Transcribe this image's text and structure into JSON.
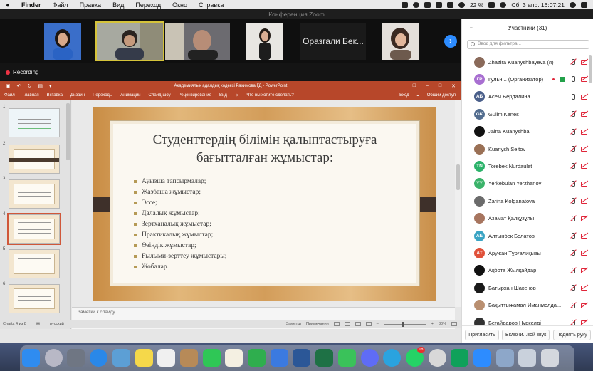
{
  "menubar": {
    "apple_icon": "apple-icon",
    "app": "Finder",
    "items": [
      "Файл",
      "Правка",
      "Вид",
      "Переход",
      "Окно",
      "Справка"
    ],
    "battery": "22 %",
    "datetime": "Сб, 3 апр.  16:07:21"
  },
  "zoom": {
    "window_title": "Конференция Zoom",
    "recording_label": "Recording",
    "name_tile": "Оразгали Бек...",
    "next_icon": "chevron-right-icon"
  },
  "ppt": {
    "doc_title": "Академиялық адалдық кодексі Рахимова ГД - PowerPoint",
    "ribbon_tabs": [
      "Файл",
      "Главная",
      "Вставка",
      "Дизайн",
      "Переходы",
      "Анимации",
      "Слайд-шоу",
      "Рецензирование",
      "Вид"
    ],
    "tell_me": "Что вы хотите сделать?",
    "sign_in": "Вход",
    "share": "Общий доступ",
    "slide_numbers": [
      "1",
      "2",
      "3",
      "4",
      "5",
      "6"
    ],
    "slide": {
      "title_line1": "Студенттердің білімін қалыптастыруға",
      "title_line2": "бағытталған жұмыстар:",
      "bullets": [
        "Ауызша тапсырмалар;",
        "Жазбаша жұмыстар;",
        "Эссе;",
        "Далалық жұмыстар;",
        "Зертханалық жұмыстар;",
        "Практикалық жұмыстар;",
        "Өзіндік жұмыстар;",
        "Ғылыми-зерттеу жұмыстары;",
        "Жобалар."
      ]
    },
    "notes_placeholder": "Заметки к слайду",
    "status": {
      "slide_of": "Слайд 4 из 8",
      "language": "русский",
      "notes": "Заметки",
      "comments": "Примечания",
      "zoom": "80%"
    }
  },
  "participants": {
    "header": "Участники (31)",
    "filter_placeholder": "Ввод для фильтра...",
    "list": [
      {
        "name": "Zhazira Kuanyshbayeva (я)",
        "initials": "",
        "color": "#8a6a5a",
        "mic": "off",
        "cam": "off"
      },
      {
        "name": "Гульн... (Организатор)",
        "initials": "ГР",
        "color": "#a86fd1",
        "mic": "on",
        "cam": "off"
      },
      {
        "name": "Асем Бердалина",
        "initials": "АБ",
        "color": "#4a5f8a",
        "mic": "on",
        "cam": "off"
      },
      {
        "name": "Gulim Kenes",
        "initials": "GK",
        "color": "#536d8f",
        "mic": "off",
        "cam": "off"
      },
      {
        "name": "Jaina Kuanyshbai",
        "initials": "",
        "color": "#121212",
        "mic": "off",
        "cam": "off"
      },
      {
        "name": "Kuanysh Seitov",
        "initials": "",
        "color": "#9a7055",
        "mic": "off",
        "cam": "off"
      },
      {
        "name": "Torebek Nurdaulet",
        "initials": "TN",
        "color": "#2bb36a",
        "mic": "off",
        "cam": "off"
      },
      {
        "name": "Yerkebulan Yerzhanov",
        "initials": "YY",
        "color": "#3bb36a",
        "mic": "off",
        "cam": "off"
      },
      {
        "name": "Zarina Kolganatova",
        "initials": "",
        "color": "#6b6b6b",
        "mic": "off",
        "cam": "off"
      },
      {
        "name": "Азамат Қалқұзұлы",
        "initials": "",
        "color": "#a7755f",
        "mic": "off",
        "cam": "off"
      },
      {
        "name": "Алтынбек Болатов",
        "initials": "АБ",
        "color": "#3aa4c4",
        "mic": "off",
        "cam": "off"
      },
      {
        "name": "Аружан Тұрғалиқызы",
        "initials": "АТ",
        "color": "#e0513a",
        "mic": "off",
        "cam": "off"
      },
      {
        "name": "Ақбота Жылқайдар",
        "initials": "",
        "color": "#111111",
        "mic": "off",
        "cam": "off"
      },
      {
        "name": "Батырхан Шакенов",
        "initials": "",
        "color": "#1a1a1a",
        "mic": "off",
        "cam": "off"
      },
      {
        "name": "Бақыттыжамал Иманмолда...",
        "initials": "",
        "color": "#b98f70",
        "mic": "off",
        "cam": "off"
      },
      {
        "name": "Бегайдаров Нуркелді",
        "initials": "",
        "color": "#333333",
        "mic": "off",
        "cam": "off"
      }
    ],
    "buttons": {
      "invite": "Пригласить",
      "unmute_all": "Включи...вой звук",
      "raise_hand": "Поднять руку"
    }
  },
  "dock": {
    "icons": [
      "finder-icon",
      "launchpad-icon",
      "mission-control-icon",
      "safari-icon",
      "preview-icon",
      "notes-icon",
      "reminders-icon",
      "contacts-icon",
      "facetime-icon",
      "pages-icon",
      "numbers-icon",
      "keynote-icon",
      "word-icon",
      "excel-icon",
      "messages-icon",
      "messenger-icon",
      "telegram-icon",
      "whatsapp-icon",
      "chrome-icon",
      "kaspersky-icon",
      "zoom-icon",
      "folder-icon",
      "image-capture-icon",
      "trash-icon"
    ],
    "whatsapp_badge": "18",
    "colors": {
      "finder": "#2f8cf0",
      "launchpad": "#b8b8c6",
      "mission": "#6f7683",
      "safari": "#2a88e8",
      "preview": "#5c9fd5",
      "notes": "#f5d84a",
      "reminders": "#f0f0f0",
      "contacts": "#b78a58",
      "facetime": "#2fc756",
      "pages": "#f4f0e2",
      "numbers": "#2fae4e",
      "keynote": "#3b7ae0",
      "word": "#2b5797",
      "excel": "#1e7145",
      "messages": "#3ac25a",
      "messenger": "#5f6cf6",
      "telegram": "#2aa3df",
      "whatsapp": "#25d366",
      "chrome": "#d8d8d8",
      "kaspersky": "#0fa15a",
      "zoom": "#2d8cff",
      "folder": "#8da7c9",
      "image_capture": "#c9d1dc",
      "trash": "#d4d8de"
    }
  }
}
